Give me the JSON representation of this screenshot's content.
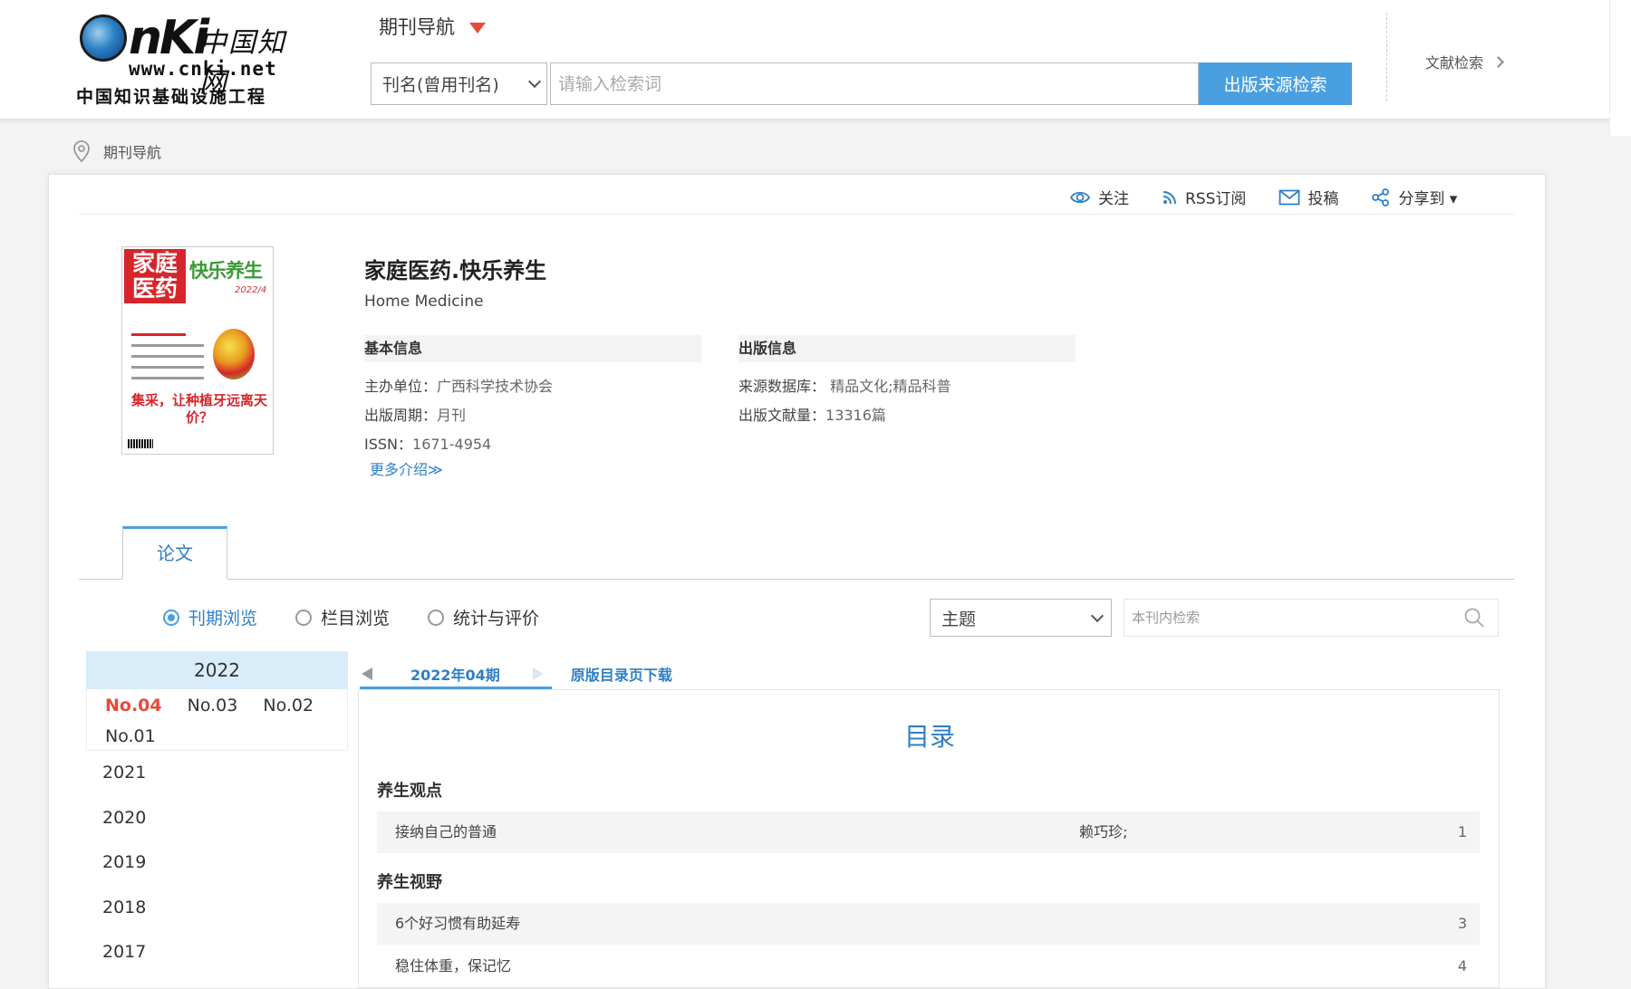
{
  "header": {
    "logo": {
      "brand": "CNKi中国知网",
      "url": "www.cnki.net",
      "subtitle": "中国知识基础设施工程"
    },
    "nav_title": "期刊导航",
    "search": {
      "field_select": "刊名(曾用刊名)",
      "placeholder": "请输入检索词",
      "button": "出版来源检索"
    },
    "doc_search": "文献检索"
  },
  "breadcrumb": {
    "current": "期刊导航"
  },
  "actions": [
    {
      "label": "关注",
      "icon": "eye-icon"
    },
    {
      "label": "RSS订阅",
      "icon": "rss-icon"
    },
    {
      "label": "投稿",
      "icon": "mail-icon"
    },
    {
      "label": "分享到 ▾",
      "icon": "share-icon"
    }
  ],
  "journal": {
    "cover": {
      "title_red": "家庭医药",
      "title_green": "快乐养生",
      "issue": "2022/4",
      "headline": "集采，让种植牙远离天价？"
    },
    "title": "家庭医药.快乐养生",
    "title_en": "Home Medicine",
    "basic_info": {
      "heading": "基本信息",
      "sponsor_label": "主办单位：",
      "sponsor": "广西科学技术协会",
      "cycle_label": "出版周期：",
      "cycle": "月刊",
      "issn_label": "ISSN：",
      "issn": "1671-4954"
    },
    "pub_info": {
      "heading": "出版信息",
      "db_label": "来源数据库：",
      "db": "精品文化;精品科普",
      "count_label": "出版文献量：",
      "count": "13316篇"
    },
    "more": "更多介绍≫"
  },
  "tabs": {
    "active": "论文"
  },
  "filters": {
    "radios": [
      {
        "label": "刊期浏览",
        "checked": true
      },
      {
        "label": "栏目浏览",
        "checked": false
      },
      {
        "label": "统计与评价",
        "checked": false
      }
    ],
    "topic_select": "主题",
    "inner_search_placeholder": "本刊内检索"
  },
  "years": {
    "active_year": "2022",
    "issues": [
      "No.04",
      "No.03",
      "No.02",
      "No.01"
    ],
    "active_issue": "No.04",
    "others": [
      "2021",
      "2020",
      "2019",
      "2018",
      "2017"
    ]
  },
  "issue_nav": {
    "current": "2022年04期",
    "download": "原版目录页下载"
  },
  "toc": {
    "title": "目录",
    "sections": [
      {
        "name": "养生观点",
        "items": [
          {
            "title": "接纳自己的普通",
            "author": "赖巧珍;",
            "page": "1"
          }
        ]
      },
      {
        "name": "养生视野",
        "items": [
          {
            "title": "6个好习惯有助延寿",
            "author": "",
            "page": "3"
          },
          {
            "title": "稳住体重，保记忆",
            "author": "",
            "page": "4"
          }
        ]
      }
    ]
  },
  "colors": {
    "accent": "#4a9fe0",
    "link": "#2f7fc6",
    "highlight": "#e84a3d"
  }
}
